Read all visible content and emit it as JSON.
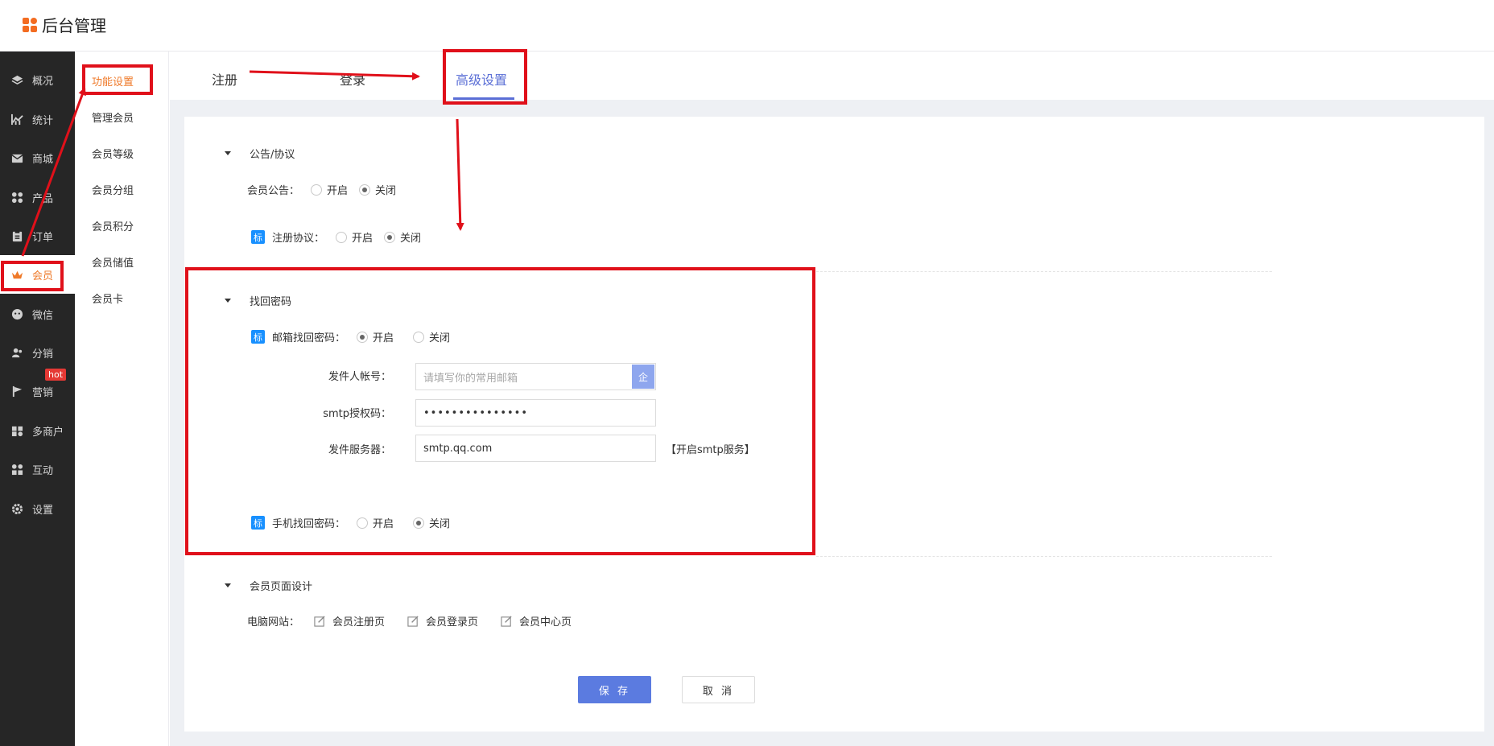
{
  "brand": {
    "title": "后台管理"
  },
  "sidebar": {
    "items": [
      {
        "label": "概况",
        "icon": "layers-icon"
      },
      {
        "label": "统计",
        "icon": "chart-icon"
      },
      {
        "label": "商城",
        "icon": "mail-icon"
      },
      {
        "label": "产品",
        "icon": "grid-icon"
      },
      {
        "label": "订单",
        "icon": "clipboard-icon"
      },
      {
        "label": "会员",
        "icon": "crown-icon"
      },
      {
        "label": "微信",
        "icon": "wechat-icon"
      },
      {
        "label": "分销",
        "icon": "users-icon"
      },
      {
        "label": "营销",
        "icon": "flag-icon"
      },
      {
        "label": "多商户",
        "icon": "store-icon"
      },
      {
        "label": "互动",
        "icon": "people-icon"
      },
      {
        "label": "设置",
        "icon": "gear-icon"
      }
    ],
    "hot_badge": "hot"
  },
  "subnav": {
    "items": [
      "功能设置",
      "管理会员",
      "会员等级",
      "会员分组",
      "会员积分",
      "会员储值",
      "会员卡"
    ]
  },
  "tabs": [
    "注册",
    "登录",
    "高级设置"
  ],
  "section1": {
    "title": "公告/协议",
    "notice_label": "会员公告：",
    "agreement_tag": "标",
    "agreement_label": "注册协议：",
    "open": "开启",
    "close": "关闭"
  },
  "section2": {
    "title": "找回密码",
    "email_tag": "标",
    "email_label": "邮箱找回密码：",
    "sender_label": "发件人帐号：",
    "sender_placeholder": "请填写你的常用邮箱",
    "sender_btn": "企",
    "smtp_label": "smtp授权码：",
    "smtp_value": "•••••••••••••••",
    "server_label": "发件服务器：",
    "server_value": "smtp.qq.com",
    "server_link": "【开启smtp服务】",
    "phone_tag": "标",
    "phone_label": "手机找回密码：",
    "open": "开启",
    "close": "关闭"
  },
  "section3": {
    "title": "会员页面设计",
    "pc_label": "电脑网站：",
    "pages": [
      "会员注册页",
      "会员登录页",
      "会员中心页"
    ]
  },
  "buttons": {
    "save": "保 存",
    "cancel": "取 消"
  },
  "colors": {
    "accent": "#5b7be0",
    "active_orange": "#ef7a2a",
    "annotation_red": "#e0101a"
  }
}
